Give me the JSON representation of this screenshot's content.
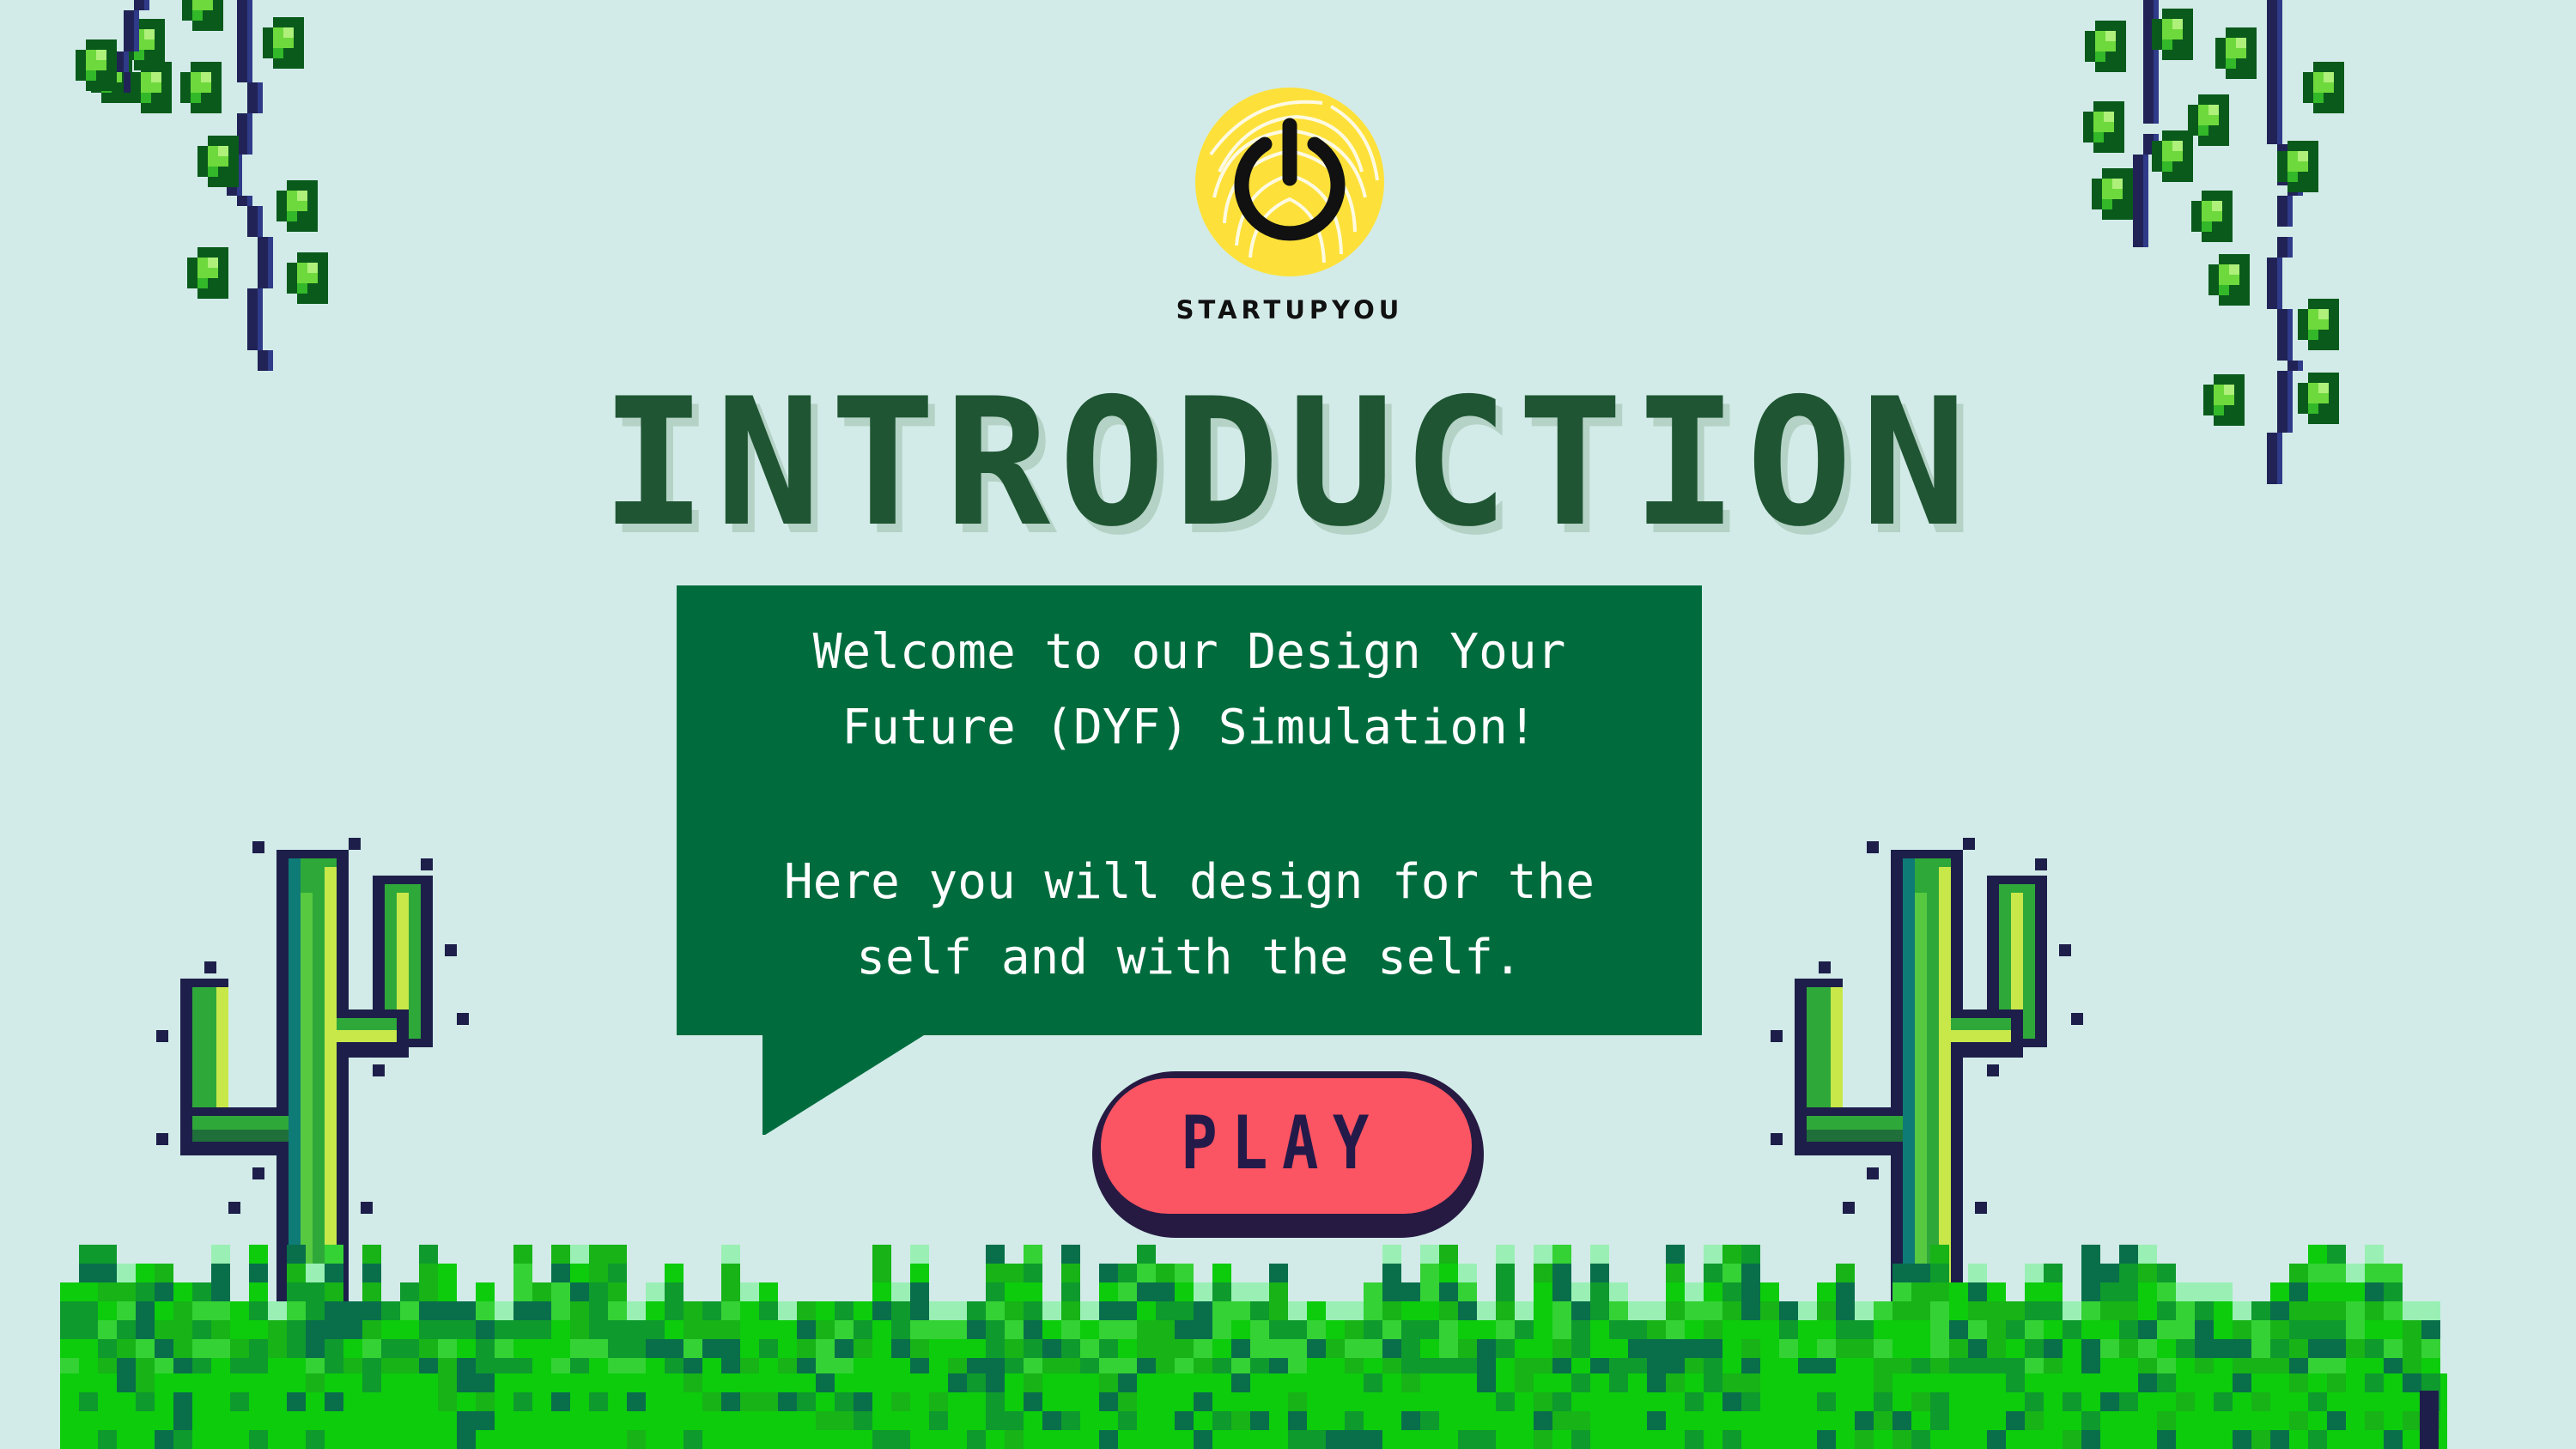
{
  "brand": {
    "logo_icon": "power-icon",
    "name": "STARTUPYOU"
  },
  "title": "INTRODUCTION",
  "dialog": {
    "line1": "Welcome to our Design Your",
    "line2": "Future (DYF) Simulation!",
    "line3": "Here you will design for the",
    "line4": "self and with the self."
  },
  "play_button": {
    "label": "PLAY"
  },
  "decor": {
    "left_vine": "vine-icon",
    "right_vine": "vine-icon",
    "left_cactus": "cactus-icon",
    "right_cactus": "cactus-icon",
    "ground": "grass-icon"
  },
  "colors": {
    "background": "#d2ebe8",
    "title": "#1f5533",
    "title_shadow": "#b4d2c5",
    "dialog_fill": "#006c3e",
    "play_fill": "#fb5462",
    "play_outline": "#261a42",
    "logo_yellow": "#fde13a",
    "grass_green": "#13c913",
    "leaf_green": "#6ed93c",
    "vine_stem": "#212357"
  }
}
